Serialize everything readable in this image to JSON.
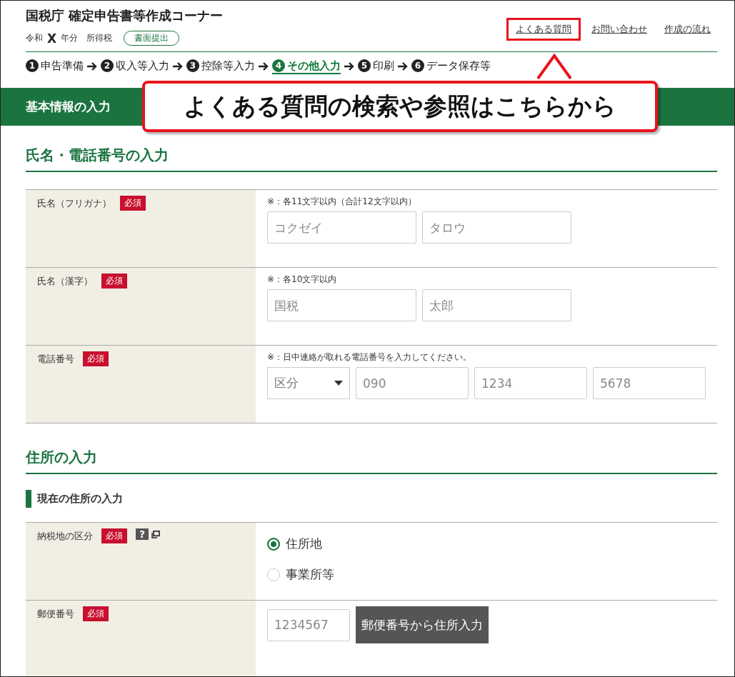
{
  "header": {
    "title": "国税庁 確定申告書等作成コーナー",
    "era": "令和",
    "year": "X",
    "year_suffix": "年分",
    "tax": "所得税",
    "mode_badge": "書面提出"
  },
  "links": [
    {
      "label": "よくある質問",
      "highlighted": true
    },
    {
      "label": "お問い合わせ",
      "highlighted": false
    },
    {
      "label": "作成の流れ",
      "highlighted": false
    }
  ],
  "steps": [
    {
      "number": "1",
      "label": "申告準備",
      "current": false
    },
    {
      "number": "2",
      "label": "収入等入力",
      "current": false
    },
    {
      "number": "3",
      "label": "控除等入力",
      "current": false
    },
    {
      "number": "4",
      "label": "その他入力",
      "current": true
    },
    {
      "number": "5",
      "label": "印刷",
      "current": false
    },
    {
      "number": "6",
      "label": "データ保存等",
      "current": false
    }
  ],
  "banner": "基本情報の入力",
  "callout": "よくある質問の検索や参照はこちらから",
  "sections": [
    {
      "title": "氏名・電話番号の入力",
      "rows": [
        {
          "label": "氏名（フリガナ）",
          "badge": "必須",
          "note": "※：各11文字以内（合計12文字以内）",
          "controls": [
            {
              "kind": "name",
              "placeholder": "コクゼイ"
            },
            {
              "kind": "name",
              "placeholder": "タロウ"
            }
          ]
        },
        {
          "label": "氏名（漢字）",
          "badge": "必須",
          "note": "※：各10文字以内",
          "controls": [
            {
              "kind": "name",
              "placeholder": "国税"
            },
            {
              "kind": "name",
              "placeholder": "太郎"
            }
          ]
        },
        {
          "label": "電話番号",
          "badge": "必須",
          "note": "※：日中連絡が取れる電話番号を入力してください。",
          "controls": [
            {
              "kind": "select",
              "placeholder": "区分"
            },
            {
              "kind": "phone",
              "placeholder": "090"
            },
            {
              "kind": "phone",
              "placeholder": "1234"
            },
            {
              "kind": "phone",
              "placeholder": "5678"
            }
          ]
        }
      ]
    },
    {
      "title": "住所の入力",
      "subtitle": "現在の住所の入力",
      "rows": [
        {
          "label": "納税地の区分",
          "badge": "必須",
          "help": "?",
          "controls": [
            {
              "kind": "radio",
              "label": "住所地",
              "selected": true
            },
            {
              "kind": "radio",
              "label": "事業所等",
              "selected": false
            }
          ]
        },
        {
          "label": "郵便番号",
          "badge": "必須",
          "controls": [
            {
              "kind": "postal",
              "placeholder": "1234567"
            },
            {
              "kind": "button",
              "label": "郵便番号から住所入力"
            }
          ]
        }
      ]
    }
  ]
}
